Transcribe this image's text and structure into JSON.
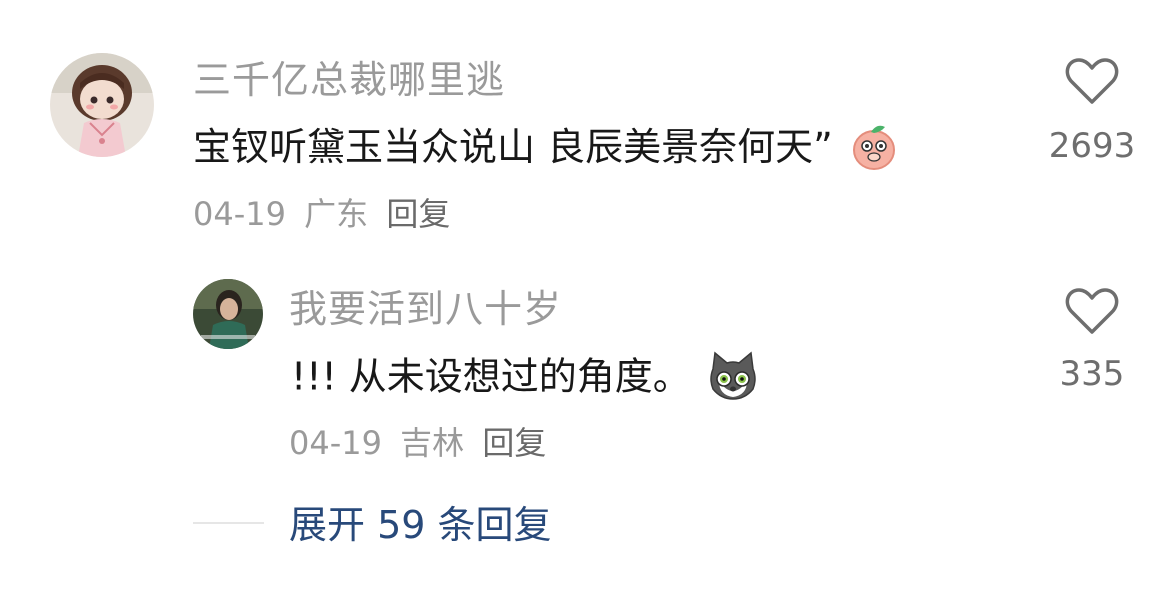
{
  "comments": [
    {
      "username": "三千亿总裁哪里逃",
      "text": "宝钗听黛玉当众说山  良辰美景奈何天”",
      "date": "04-19",
      "location": "广东",
      "reply_label": "回复",
      "likes": "2693",
      "avatar_icon": "doll-avatar",
      "emoji_icon": "peach-shy-emoji"
    },
    {
      "username": "我要活到八十岁",
      "text": "!!! 从未设想过的角度。",
      "date": "04-19",
      "location": "吉林",
      "reply_label": "回复",
      "likes": "335",
      "avatar_icon": "person-photo-avatar",
      "emoji_icon": "shocked-cat-emoji"
    }
  ],
  "expand_replies": "展开 59 条回复",
  "colors": {
    "username": "#9a9a9a",
    "text": "#181818",
    "meta": "#9a9a9a",
    "link": "#28497a",
    "icon": "#6e6e6e"
  }
}
